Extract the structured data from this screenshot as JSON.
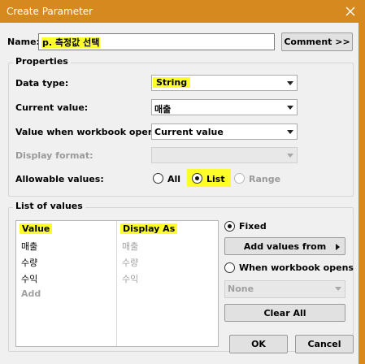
{
  "window": {
    "title": "Create Parameter"
  },
  "name": {
    "label": "Name:",
    "value": "p. 측정값 선택"
  },
  "buttons": {
    "comment": "Comment >>",
    "add_values_from": "Add values from",
    "clear_all": "Clear All",
    "ok": "OK",
    "cancel": "Cancel"
  },
  "properties": {
    "title": "Properties",
    "data_type": {
      "label": "Data type:",
      "value": "String"
    },
    "current_value": {
      "label": "Current value:",
      "value": "매출"
    },
    "workbook_opens": {
      "label": "Value when workbook opens:",
      "value": "Current value"
    },
    "display_format": {
      "label": "Display format:",
      "value": ""
    },
    "allowable": {
      "label": "Allowable values:",
      "options": [
        "All",
        "List",
        "Range"
      ],
      "selected": "List"
    }
  },
  "list": {
    "title": "List of values",
    "col_value": "Value",
    "col_display": "Display As",
    "rows": [
      {
        "value": "매출",
        "display": "매출"
      },
      {
        "value": "수량",
        "display": "수량"
      },
      {
        "value": "수익",
        "display": "수익"
      }
    ],
    "add_label": "Add",
    "fixed_label": "Fixed",
    "when_opens_label": "When workbook opens",
    "none_value": "None",
    "selected_mode": "Fixed"
  },
  "colors": {
    "titlebar": "#d6891f",
    "highlight": "#fdfd2a"
  }
}
